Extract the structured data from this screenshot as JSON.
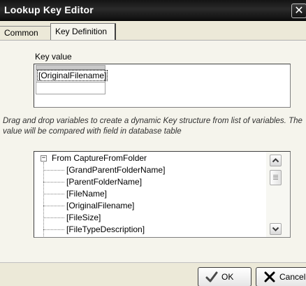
{
  "window": {
    "title": "Lookup Key Editor",
    "close_glyph": "✕"
  },
  "tabs": [
    {
      "label": "Common",
      "active": false
    },
    {
      "label": "Key Definition",
      "active": true
    }
  ],
  "key_value": {
    "label": "Key value",
    "tokens": [
      "[OriginalFilename]"
    ]
  },
  "instructions": "Drag and drop variables to create a dynamic Key structure from list of variables. The value will be compared with field in database table",
  "tree": {
    "toggle_glyph": "−",
    "root_label": "From CaptureFromFolder",
    "expanded": true,
    "items": [
      "[GrandParentFolderName]",
      "[ParentFolderName]",
      "[FileName]",
      "[OriginalFilename]",
      "[FileSize]",
      "[FileTypeDescription]"
    ]
  },
  "buttons": {
    "ok_label": "OK",
    "cancel_label": "Cancel"
  },
  "icons": {
    "close": "close-icon",
    "ok": "check-icon",
    "cancel": "x-icon",
    "scroll_up": "chevron-up-icon",
    "scroll_down": "chevron-down-icon",
    "tree_toggle": "minus-box-icon"
  },
  "colors": {
    "titlebar": "#141414",
    "dialog_bg": "#ece9d8",
    "panel_bg": "#f5f4ec",
    "ok_check": "#4a4a4a",
    "cancel_x": "#000000"
  }
}
